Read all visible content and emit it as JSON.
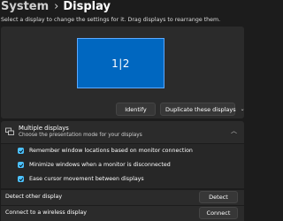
{
  "breadcrumb": {
    "root": "System",
    "separator": "›",
    "current": "Display"
  },
  "instructions": "Select a display to change the settings for it. Drag displays to rearrange them.",
  "arrangement": {
    "monitor_label": "1|2",
    "identify_label": "Identify",
    "duplicate_select": {
      "selected": "Duplicate these displays",
      "chevron_icon": "chevron-down-icon"
    }
  },
  "multiple_displays": {
    "icon": "multiple-displays-icon",
    "title": "Multiple displays",
    "subtitle": "Choose the presentation mode for your displays",
    "expanded": true,
    "options": [
      {
        "label": "Remember window locations based on monitor connection",
        "checked": true
      },
      {
        "label": "Minimize windows when a monitor is disconnected",
        "checked": true
      },
      {
        "label": "Ease cursor movement between displays",
        "checked": true
      }
    ],
    "detect": {
      "label": "Detect other display",
      "button": "Detect"
    },
    "connect": {
      "label": "Connect to a wireless display",
      "button": "Connect"
    }
  },
  "colors": {
    "background": "#1c1c1c",
    "panel": "#2b2b2b",
    "accent": "#4cc2ff",
    "monitor_fill": "#0067c0"
  }
}
